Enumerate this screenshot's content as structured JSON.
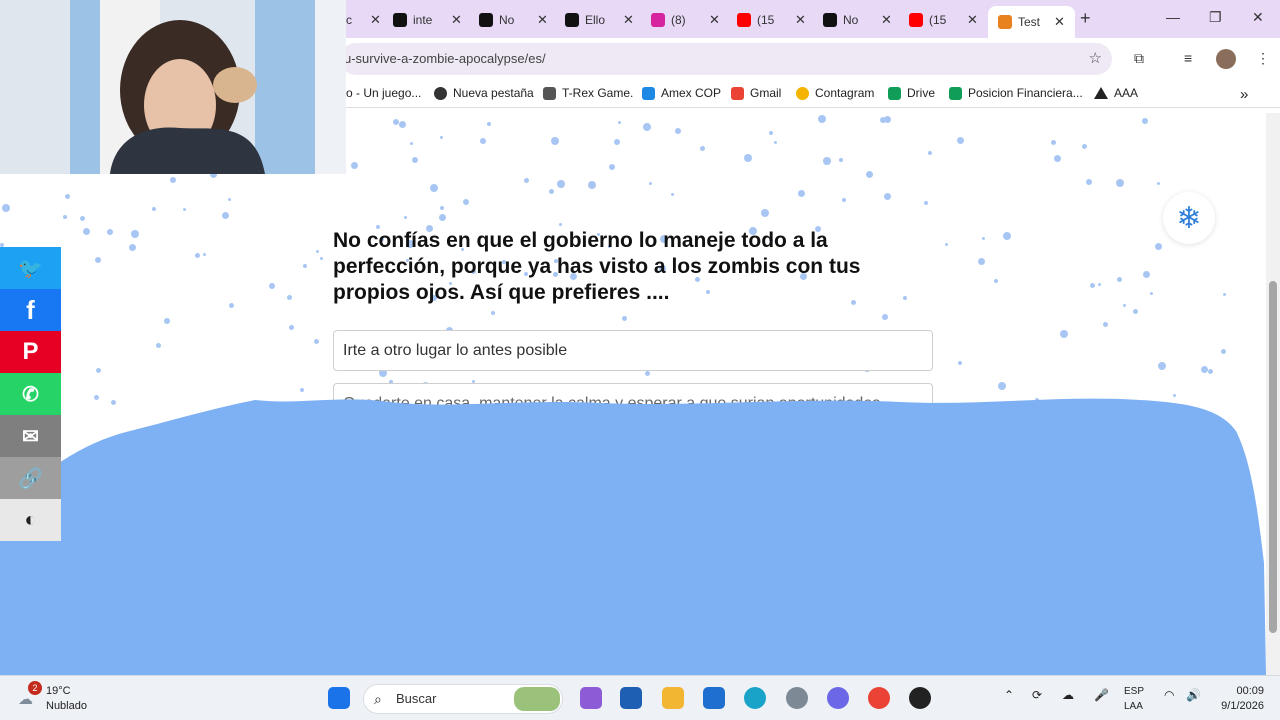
{
  "tabs": [
    {
      "title": "c",
      "icon": "generic-tab-icon",
      "color": "#888888",
      "x": 0
    },
    {
      "title": "inte",
      "icon": "tiktok-icon",
      "color": "#111111"
    },
    {
      "title": "No",
      "icon": "tiktok-icon",
      "color": "#111111"
    },
    {
      "title": "Ello",
      "icon": "tiktok-icon",
      "color": "#111111"
    },
    {
      "title": "(8)",
      "icon": "instagram-icon",
      "color": "#d6249f"
    },
    {
      "title": "(15",
      "icon": "youtube-icon",
      "color": "#ff0000"
    },
    {
      "title": "No",
      "icon": "tiktok-icon",
      "color": "#111111"
    },
    {
      "title": "(15",
      "icon": "youtube-icon",
      "color": "#ff0000"
    },
    {
      "title": "Test",
      "icon": "fox-icon",
      "color": "#e8821e",
      "active": true
    }
  ],
  "toolbar": {
    "url": "u-survive-a-zombie-apocalypse/es/"
  },
  "bookmarks": [
    {
      "label": "o - Un juego...",
      "color": "#888888"
    },
    {
      "label": "Nueva pestaña",
      "color": "#333333"
    },
    {
      "label": "T-Rex Game.",
      "color": "#555555"
    },
    {
      "label": "Amex COP",
      "color": "#1e88e5"
    },
    {
      "label": "Gmail",
      "color": "#ea4335"
    },
    {
      "label": "Contagram",
      "color": "#f4b400"
    },
    {
      "label": "Drive",
      "color": "#0f9d58"
    },
    {
      "label": "Posicion Financiera...",
      "color": "#0f9d58"
    },
    {
      "label": "AAA",
      "color": "#222222"
    }
  ],
  "quiz": {
    "question": "No confías en que el gobierno lo maneje todo a la perfección, porque ya has visto a los zombis con tus propios ojos. Así que prefieres ....",
    "options": [
      "Irte a otro lugar lo antes posible",
      "Quedarte en casa, mantener la calma y esperar a que surjan oportunidades"
    ]
  },
  "share": [
    {
      "name": "twitter",
      "glyph": "🐦",
      "color": "#1da1f2"
    },
    {
      "name": "facebook",
      "glyph": "f",
      "color": "#1877f2"
    },
    {
      "name": "pinterest",
      "glyph": "P",
      "color": "#e60023"
    },
    {
      "name": "whatsapp",
      "glyph": "✆",
      "color": "#25d366"
    },
    {
      "name": "email",
      "glyph": "✉",
      "color": "#7f7f7f"
    },
    {
      "name": "link",
      "glyph": "🔗",
      "color": "#9e9e9e"
    },
    {
      "name": "theme",
      "glyph": "◐",
      "color": "#cfcfcf"
    }
  ],
  "taskbar": {
    "weather_temp": "19°C",
    "weather_desc": "Nublado",
    "weather_badge": "2",
    "search_placeholder": "Buscar",
    "lang_top": "ESP",
    "lang_bottom": "LAA",
    "time": "00:09",
    "date": "9/1/2026"
  },
  "colors": {
    "water": "#7eb0f4",
    "snow": "#a8c6f3",
    "tabstrip": "#e8d9f6"
  }
}
